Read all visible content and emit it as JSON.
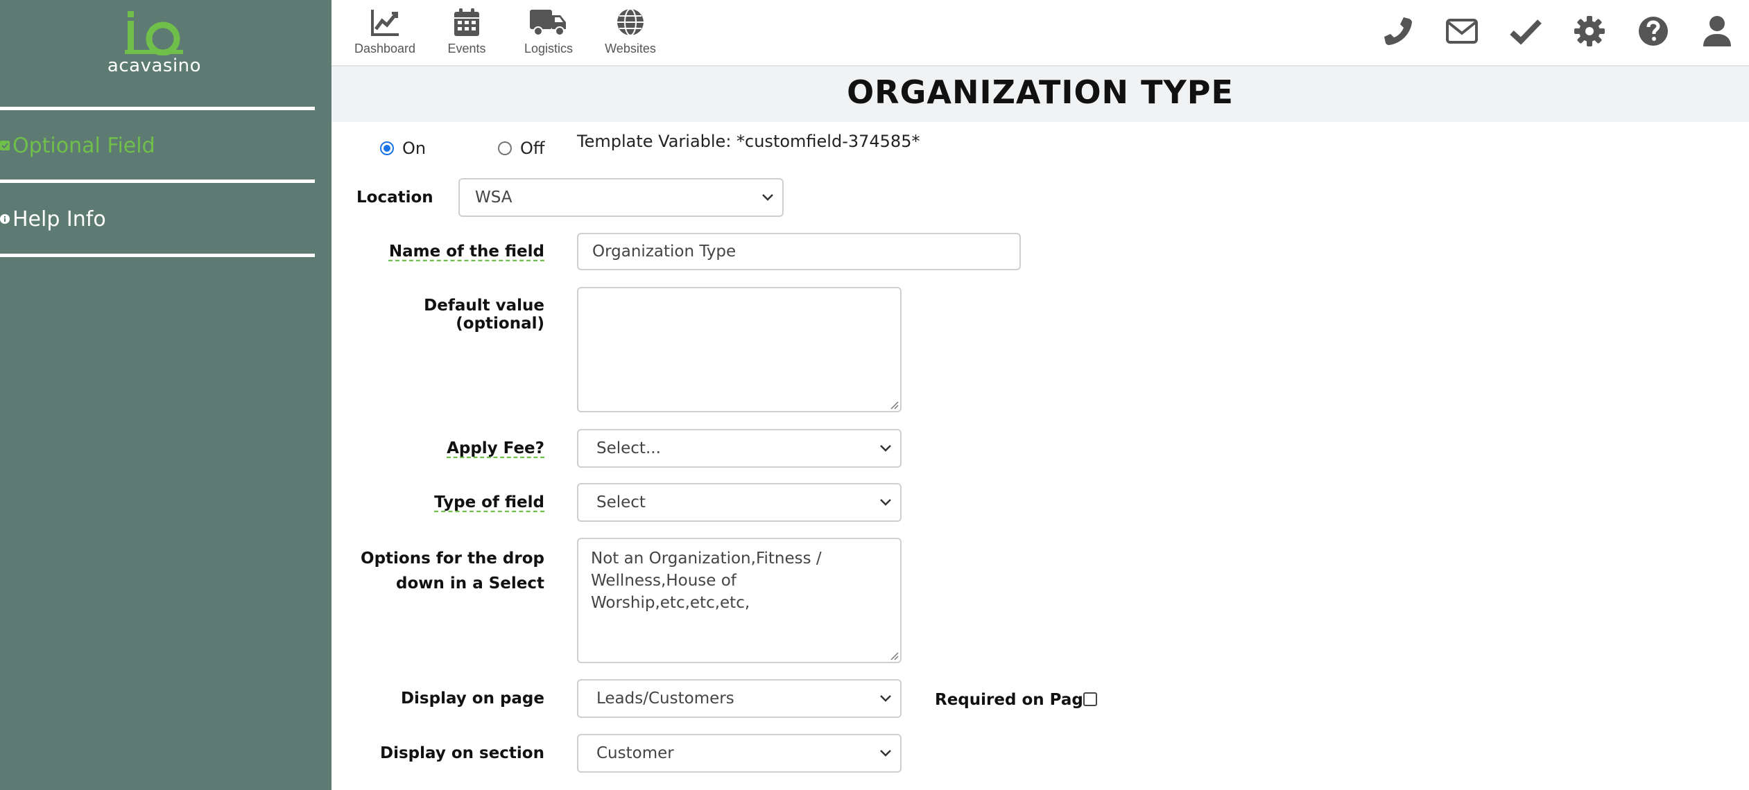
{
  "sidebar": {
    "logo_text": "acavasino",
    "items": [
      {
        "label": "Optional Field",
        "icon": "check-square-icon",
        "color": "#6fbf4a"
      },
      {
        "label": "Help Info",
        "icon": "info-circle-icon",
        "color": "#ffffff"
      }
    ]
  },
  "topnav": {
    "items": [
      {
        "label": "Dashboard",
        "icon": "chart-line-icon"
      },
      {
        "label": "Events",
        "icon": "calendar-icon"
      },
      {
        "label": "Logistics",
        "icon": "truck-icon"
      },
      {
        "label": "Websites",
        "icon": "globe-icon"
      }
    ],
    "right_icons": [
      "phone-icon",
      "envelope-icon",
      "check-icon",
      "gear-icon",
      "question-circle-icon",
      "user-icon"
    ]
  },
  "page": {
    "title": "ORGANIZATION TYPE"
  },
  "form": {
    "status": {
      "on_label": "On",
      "off_label": "Off",
      "selected": "On"
    },
    "template_variable": "Template Variable: *customfield-374585*",
    "location": {
      "label": "Location",
      "value": "WSA"
    },
    "name_of_field": {
      "label": "Name of the field",
      "value": "Organization Type"
    },
    "default_value": {
      "label": "Default value (optional)",
      "value": ""
    },
    "apply_fee": {
      "label": "Apply Fee?",
      "value": "Select..."
    },
    "type_of_field": {
      "label": "Type of field",
      "value": "Select"
    },
    "options": {
      "label_line1": "Options for the drop",
      "label_line2": "down in a Select",
      "line1": "Not an Organization,Fitness /",
      "line2": "Wellness,House of",
      "line3": "Worship,etc,etc,etc,"
    },
    "display_on_page": {
      "label": "Display on page",
      "value": "Leads/Customers"
    },
    "required_on_page": {
      "label": "Required on Page",
      "checked": false
    },
    "display_on_section": {
      "label": "Display on section",
      "value": "Customer"
    }
  },
  "colors": {
    "sidebar_bg": "#5e7b73",
    "accent_green": "#6fbf4a",
    "radio_blue": "#1a73e8"
  }
}
